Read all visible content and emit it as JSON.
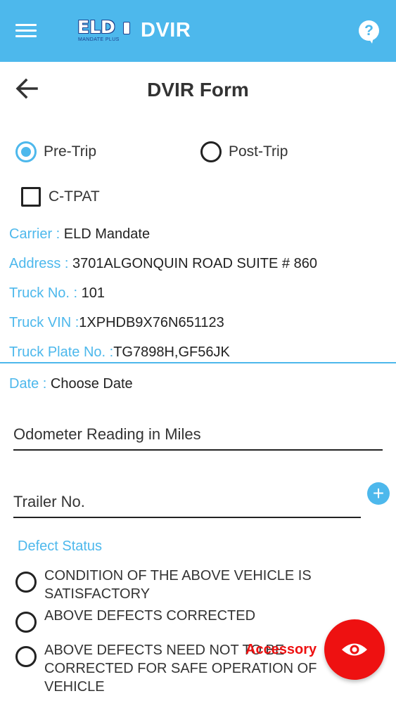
{
  "app_bar": {
    "menu_icon": "hamburger-menu-icon",
    "logo_main": "ELD",
    "logo_sub": "MANDATE PLUS",
    "title": "DVIR",
    "help_icon": "help-question-icon",
    "color": "#4db8ec"
  },
  "header": {
    "back_icon": "arrow-back-icon",
    "title": "DVIR Form"
  },
  "trip_type": {
    "options": [
      {
        "label": "Pre-Trip",
        "selected": true
      },
      {
        "label": "Post-Trip",
        "selected": false
      }
    ]
  },
  "ctpat": {
    "label": "C-TPAT",
    "checked": false
  },
  "info": {
    "carrier": {
      "label": "Carrier : ",
      "value": "ELD Mandate"
    },
    "address": {
      "label": "Address : ",
      "value": "3701ALGONQUIN ROAD SUITE # 860"
    },
    "truck_no": {
      "label": "Truck No. : ",
      "value": "101"
    },
    "truck_vin": {
      "label": "Truck VIN :",
      "value": "1XPHDB9X76N651123"
    },
    "truck_plate": {
      "label": "Truck Plate No. :",
      "value": "TG7898H,GF56JK"
    },
    "date": {
      "label": "Date : ",
      "value": "Choose Date"
    }
  },
  "fields": {
    "odometer_placeholder": "Odometer Reading in Miles",
    "trailer_placeholder": "Trailer No."
  },
  "defect_status": {
    "title": "Defect Status",
    "options": [
      "CONDITION OF THE ABOVE VEHICLE IS SATISFACTORY",
      "ABOVE DEFECTS CORRECTED",
      "ABOVE DEFECTS NEED NOT TO BE CORRECTED FOR SAFE OPERATION OF VEHICLE"
    ]
  },
  "fab": {
    "icon": "eye-icon",
    "tooltip": "Accessory",
    "color": "#ee1111"
  }
}
